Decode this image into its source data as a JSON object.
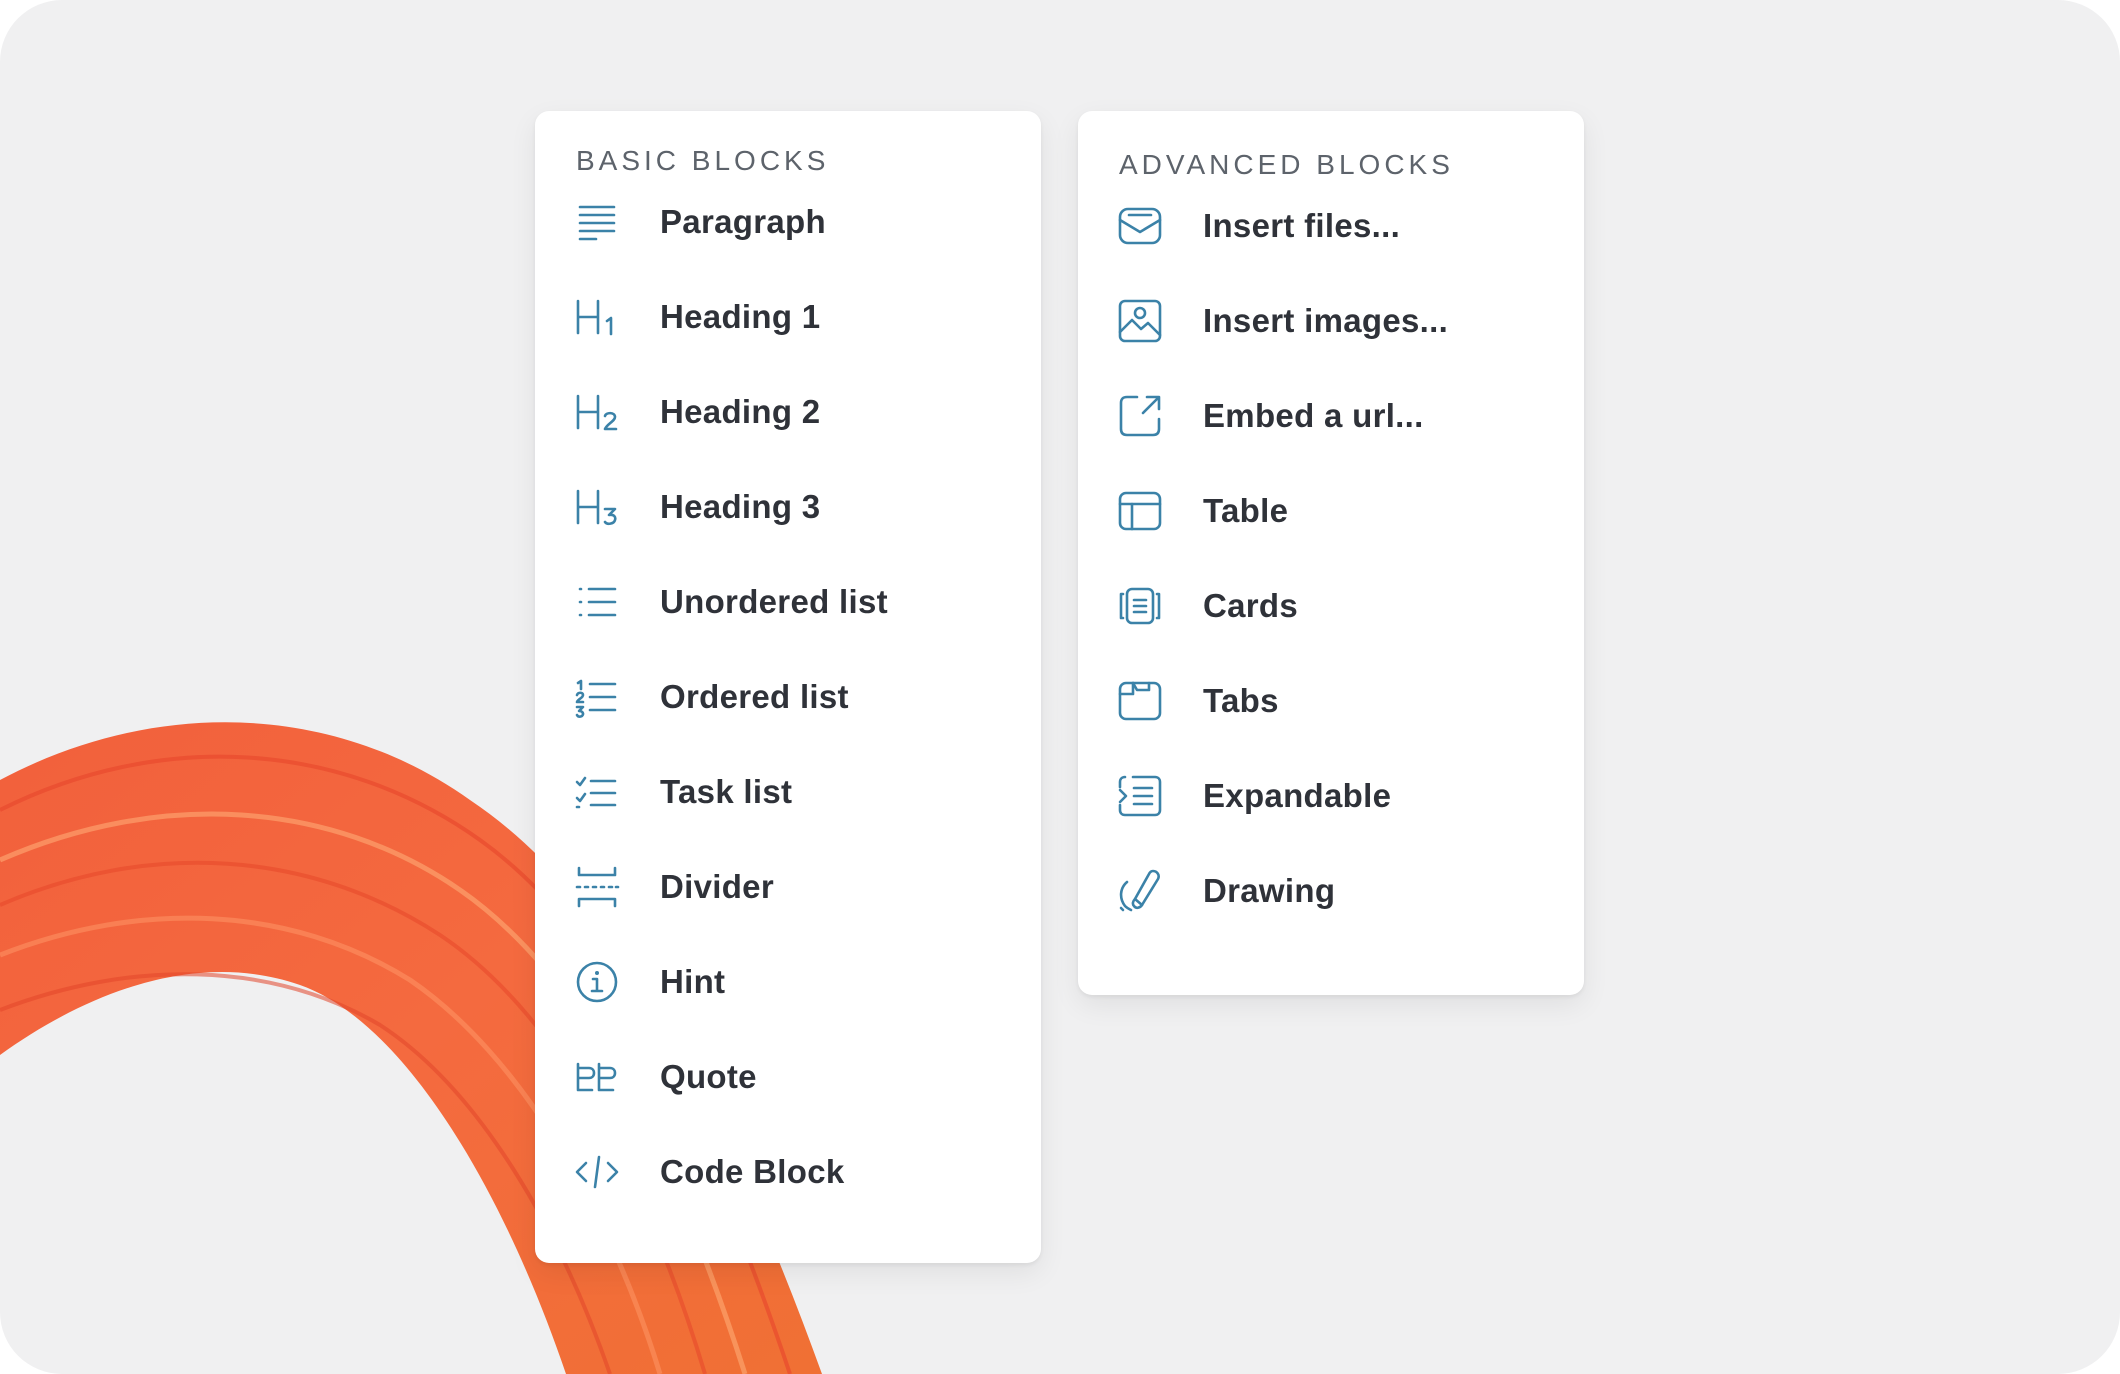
{
  "colors": {
    "background": "#f0f0f1",
    "panel": "#ffffff",
    "icon_accent": "#3b82a8",
    "label_text": "#2f3239",
    "heading_text": "#5d636b",
    "ribbon": "#f4653e"
  },
  "basic": {
    "title": "BASIC BLOCKS",
    "items": [
      {
        "label": "Paragraph",
        "icon": "paragraph-icon"
      },
      {
        "label": "Heading 1",
        "icon": "heading-1-icon"
      },
      {
        "label": "Heading 2",
        "icon": "heading-2-icon"
      },
      {
        "label": "Heading 3",
        "icon": "heading-3-icon"
      },
      {
        "label": "Unordered list",
        "icon": "unordered-list-icon"
      },
      {
        "label": "Ordered list",
        "icon": "ordered-list-icon"
      },
      {
        "label": "Task list",
        "icon": "task-list-icon"
      },
      {
        "label": "Divider",
        "icon": "divider-icon"
      },
      {
        "label": "Hint",
        "icon": "info-icon"
      },
      {
        "label": "Quote",
        "icon": "quote-icon"
      },
      {
        "label": "Code Block",
        "icon": "code-icon"
      }
    ]
  },
  "advanced": {
    "title": "ADVANCED BLOCKS",
    "items": [
      {
        "label": "Insert files...",
        "icon": "file-inbox-icon"
      },
      {
        "label": "Insert images...",
        "icon": "image-icon"
      },
      {
        "label": "Embed a url...",
        "icon": "external-link-icon"
      },
      {
        "label": "Table",
        "icon": "table-icon"
      },
      {
        "label": "Cards",
        "icon": "cards-icon"
      },
      {
        "label": "Tabs",
        "icon": "tabs-icon"
      },
      {
        "label": "Expandable",
        "icon": "expandable-icon"
      },
      {
        "label": "Drawing",
        "icon": "drawing-icon"
      }
    ]
  }
}
